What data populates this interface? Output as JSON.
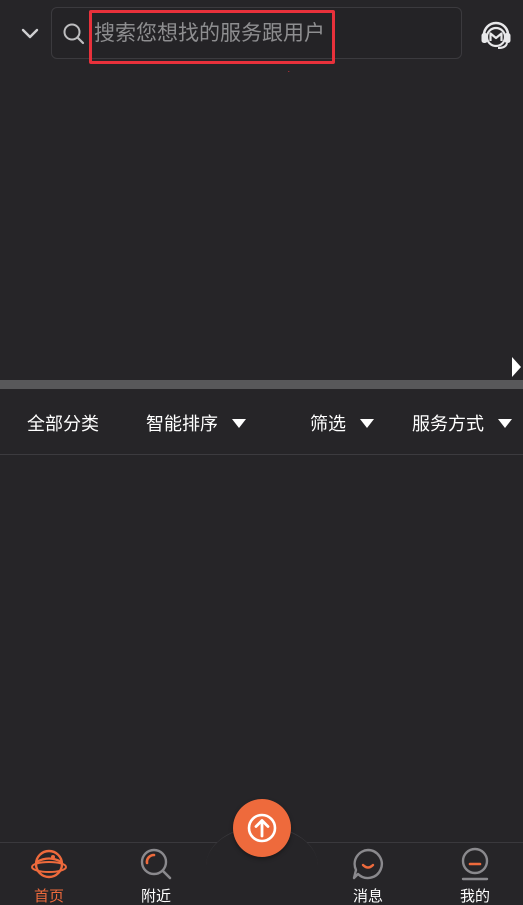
{
  "header": {
    "location_toggle_icon": "chevron-down-icon",
    "search": {
      "placeholder": "搜索您想找的服务跟用户",
      "icon": "search-icon"
    },
    "service_icon": "customer-service-icon"
  },
  "filter_bar": {
    "items": [
      {
        "label": "全部分类",
        "has_caret": false
      },
      {
        "label": "智能排序",
        "has_caret": true
      },
      {
        "label": "筛选",
        "has_caret": true
      },
      {
        "label": "服务方式",
        "has_caret": true
      }
    ]
  },
  "bottom_nav": {
    "items": [
      {
        "label": "首页",
        "icon": "planet-icon",
        "active": true
      },
      {
        "label": "附近",
        "icon": "nearby-search-icon",
        "active": false
      },
      {
        "label": "消息",
        "icon": "chat-bubble-icon",
        "active": false
      },
      {
        "label": "我的",
        "icon": "profile-icon",
        "active": false
      }
    ],
    "publish_icon": "upload-arrow-icon"
  },
  "colors": {
    "background": "#262528",
    "accent": "#ee6a3c",
    "annotation_red": "#e8313b",
    "inactive_icon": "#8a898d"
  }
}
